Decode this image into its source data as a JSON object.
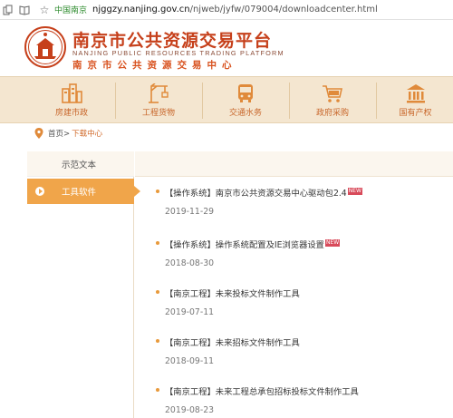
{
  "browser": {
    "site_label": "中国南京",
    "url_host": "njggzy.nanjing.gov.cn",
    "url_path": "/njweb/jyfw/079004/downloadcenter.html"
  },
  "header": {
    "title_cn": "南京市公共资源交易平台",
    "title_en": "NANJING PUBLIC RESOURCES TRADING PLATFORM",
    "title_sub": "南京市公共资源交易中心"
  },
  "nav": {
    "items": [
      {
        "label": "房建市政",
        "icon": "buildings-icon"
      },
      {
        "label": "工程货物",
        "icon": "crane-icon"
      },
      {
        "label": "交通水务",
        "icon": "bus-icon"
      },
      {
        "label": "政府采购",
        "icon": "cart-icon"
      },
      {
        "label": "国有产权",
        "icon": "bank-icon"
      }
    ]
  },
  "breadcrumb": {
    "home": "首页>",
    "current": "下载中心"
  },
  "sidebar": {
    "items": [
      {
        "label": "示范文本",
        "active": false
      },
      {
        "label": "工具软件",
        "active": true
      }
    ]
  },
  "downloads": {
    "new_badge": "NEW",
    "items": [
      {
        "title": "【操作系统】南京市公共资源交易中心驱动包2.4",
        "date": "2019-11-29",
        "is_new": true
      },
      {
        "title": "【操作系统】操作系统配置及IE浏览器设置",
        "date": "2018-08-30",
        "is_new": true
      },
      {
        "title": "【南京工程】未来投标文件制作工具",
        "date": "2019-07-11",
        "is_new": false
      },
      {
        "title": "【南京工程】未来招标文件制作工具",
        "date": "2018-09-11",
        "is_new": false
      },
      {
        "title": "【南京工程】未来工程总承包招标投标文件制作工具",
        "date": "2019-08-23",
        "is_new": false
      }
    ]
  },
  "colors": {
    "brand_red": "#c6401b",
    "accent_orange": "#f0a54a",
    "nav_bg": "#f4e6d0"
  }
}
